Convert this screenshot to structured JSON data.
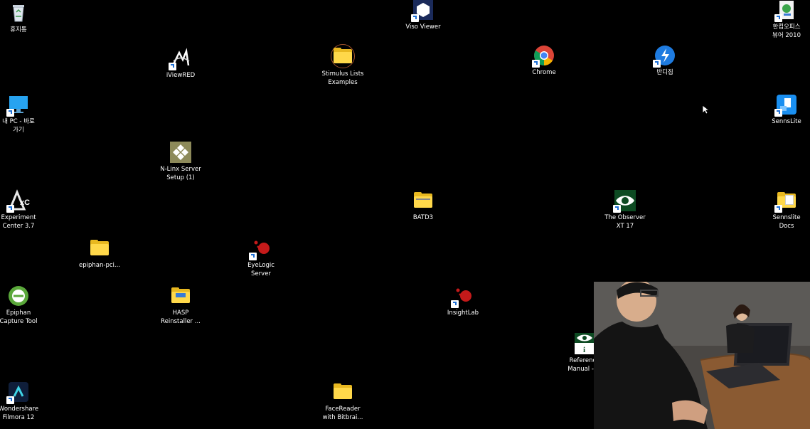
{
  "desktop": {
    "icons": [
      {
        "key": "recycle",
        "label": "휴지통"
      },
      {
        "key": "viso",
        "label": "Viso Viewer"
      },
      {
        "key": "hancom",
        "label": "한컴오피스\n뷰어 2010"
      },
      {
        "key": "iviewred",
        "label": "iViewRED"
      },
      {
        "key": "stimulus",
        "label": "Stimulus Lists\nExamples"
      },
      {
        "key": "chrome",
        "label": "Chrome"
      },
      {
        "key": "bandizip",
        "label": "반디집"
      },
      {
        "key": "mypc",
        "label": "내 PC - 바로\n가기"
      },
      {
        "key": "sennslite",
        "label": "SennsLite"
      },
      {
        "key": "nlinx",
        "label": "N-Linx Server\nSetup (1)"
      },
      {
        "key": "experiment",
        "label": "Experiment\nCenter 3.7"
      },
      {
        "key": "batd3",
        "label": "BATD3"
      },
      {
        "key": "observer",
        "label": "The Observer\nXT 17"
      },
      {
        "key": "sennsdocs",
        "label": "Sennslite\nDocs"
      },
      {
        "key": "epiphanpci",
        "label": "epiphan-pci..."
      },
      {
        "key": "eyelogic",
        "label": "EyeLogic\nServer"
      },
      {
        "key": "epiphancap",
        "label": "Epiphan\nCapture Tool"
      },
      {
        "key": "hasp",
        "label": "HASP\nReinstaller ..."
      },
      {
        "key": "insightlab",
        "label": "InsightLab"
      },
      {
        "key": "reference",
        "label": "Reference\nManual - ..."
      },
      {
        "key": "filmora",
        "label": "Wondershare\nFilmora 12"
      },
      {
        "key": "facereader",
        "label": "FaceReader\nwith Bitbrai..."
      }
    ]
  },
  "colors": {
    "background": "#000000",
    "folder": "#ffd84a",
    "shortcut_arrow": "#1d6fd6"
  }
}
